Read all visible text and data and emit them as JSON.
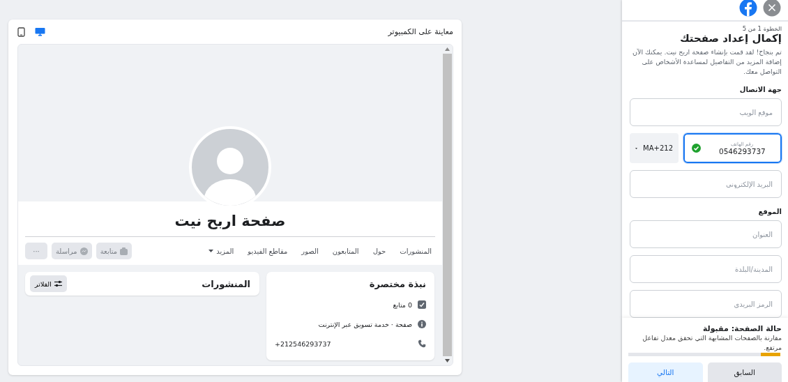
{
  "preview": {
    "title": "معاينة على الكمبيوتر",
    "devices": [
      {
        "kind": "mobile",
        "selected": false
      },
      {
        "kind": "desktop",
        "selected": true
      }
    ],
    "page": {
      "name": "صفحة اربح نيت",
      "tabs": [
        {
          "label": "المنشورات",
          "kind": "link"
        },
        {
          "label": "حول",
          "kind": "link"
        },
        {
          "label": "المتابعون",
          "kind": "link"
        },
        {
          "label": "الصور",
          "kind": "link"
        },
        {
          "label": "مقاطع الفيديو",
          "kind": "link"
        },
        {
          "label": "المزيد",
          "kind": "dropdown"
        }
      ],
      "actions": [
        {
          "label": "متابعة",
          "kind": "follow",
          "disabled": true
        },
        {
          "label": "مراسلة",
          "kind": "message",
          "disabled": true
        },
        {
          "label": "···",
          "kind": "more",
          "disabled": true
        }
      ],
      "intro": {
        "title": "نبذة مختصرة",
        "items": [
          {
            "kind": "followers",
            "text": "0 متابع"
          },
          {
            "kind": "info",
            "text": "صفحة · خدمة تسويق عبر الإنترنت"
          },
          {
            "kind": "phone",
            "text": "+212546293737"
          }
        ]
      },
      "posts": {
        "title": "المنشورات",
        "filter_button": "الفلاتر"
      }
    }
  },
  "setup": {
    "step": "الخطوة 1 من 5",
    "title": "إكمال إعداد صفحتك",
    "description": "تم بنجاح! لقد قمت بإنشاء صفحة اربح نيت. يمكنك الآن إضافة المزيد من التفاصيل لمساعدة الأشخاص على التواصل معك.",
    "sections": [
      {
        "heading": "جهة الاتصال",
        "fields": [
          {
            "kind": "text",
            "placeholder": "موقع الويب"
          },
          {
            "kind": "phone",
            "label": "رقم الهاتف",
            "value": "0546293737",
            "country": "MA+212",
            "valid": true,
            "focused": true
          },
          {
            "kind": "text",
            "placeholder": "البريد الإلكتروني"
          }
        ]
      },
      {
        "heading": "الموقع",
        "fields": [
          {
            "kind": "text",
            "placeholder": "العنوان"
          },
          {
            "kind": "text",
            "placeholder": "المدينة/البلدة"
          },
          {
            "kind": "text",
            "placeholder": "الرمز البريدي"
          }
        ]
      }
    ],
    "status": {
      "title": "حالة الصفحة: مقبولة",
      "text": "مقارنة بالصفحات المشابهة التي تحقق معدل تفاعل مرتفع.",
      "level": 0.13
    },
    "buttons": [
      {
        "label": "السابق",
        "kind": "secondary"
      },
      {
        "label": "التالي",
        "kind": "primary"
      }
    ]
  }
}
